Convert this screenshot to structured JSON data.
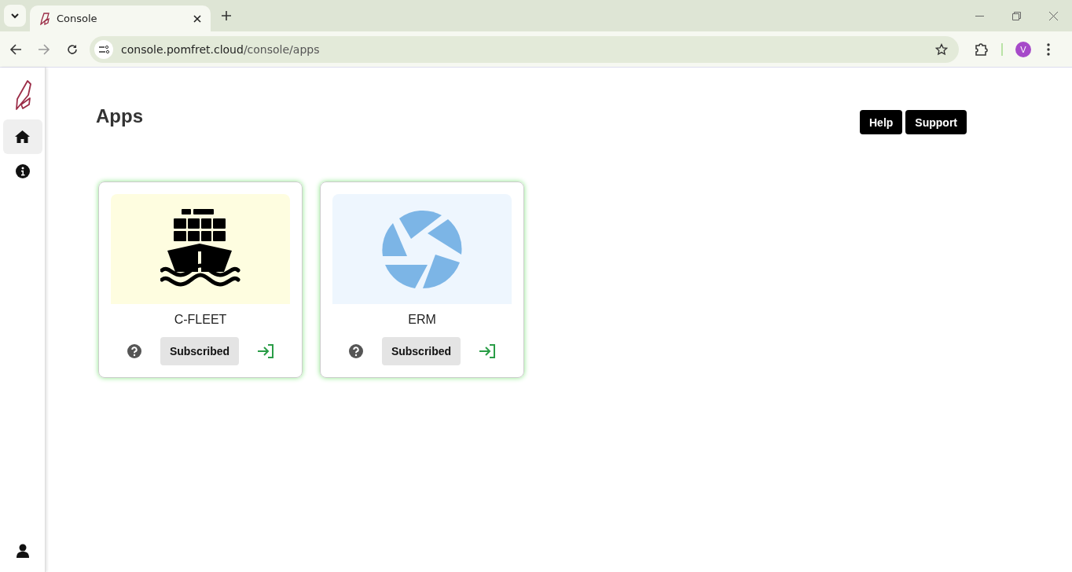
{
  "browser": {
    "tab_title": "Console",
    "url_host": "console.pomfret.cloud",
    "url_path": "/console/apps",
    "profile_initial": "V"
  },
  "sidebar": {
    "items": [
      {
        "kind": "home",
        "selected": true
      },
      {
        "kind": "info",
        "selected": false
      }
    ]
  },
  "page": {
    "title": "Apps",
    "buttons": [
      "Help",
      "Support"
    ]
  },
  "apps": [
    {
      "name": "C-FLEET",
      "kind": "ship",
      "status": "Subscribed"
    },
    {
      "name": "ERM",
      "kind": "aperture",
      "status": "Subscribed"
    }
  ]
}
